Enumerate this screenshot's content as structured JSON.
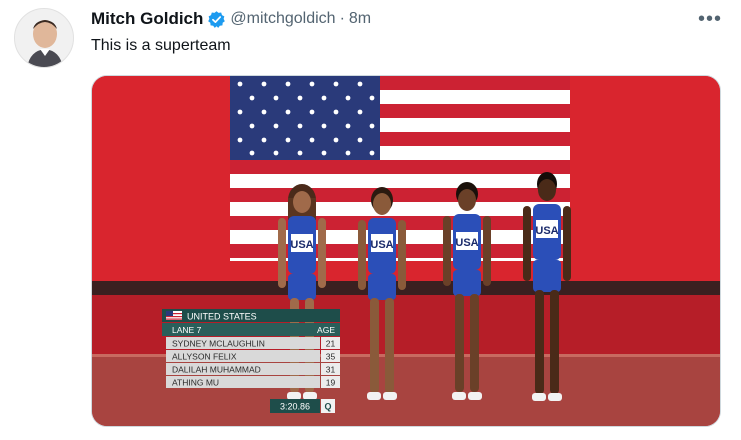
{
  "tweet": {
    "author_name": "Mitch Goldich",
    "handle": "@mitchgoldich",
    "separator": "·",
    "time": "8m",
    "text": "This is a superteam",
    "more_label": "•••"
  },
  "media": {
    "bib_text": "USA",
    "overlay": {
      "country": "UNITED STATES",
      "lane": "LANE 7",
      "age_header": "AGE",
      "athletes": [
        {
          "name": "SYDNEY MCLAUGHLIN",
          "age": "21"
        },
        {
          "name": "ALLYSON FELIX",
          "age": "35"
        },
        {
          "name": "DALILAH MUHAMMAD",
          "age": "31"
        },
        {
          "name": "ATHING MU",
          "age": "19"
        }
      ],
      "time": "3:20.86",
      "qualifier": "Q"
    }
  },
  "colors": {
    "verified": "#1d9bf0",
    "backdrop_red": "#d9252e",
    "track": "#a84440",
    "overlay_green": "#1e4d4a",
    "overlay_gray": "#d9d9d9",
    "uniform_blue": "#2b4fb8"
  }
}
